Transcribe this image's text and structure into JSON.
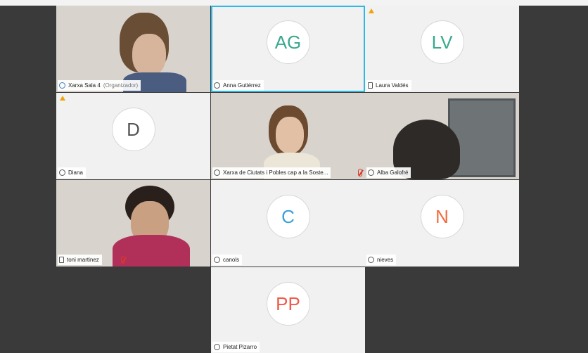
{
  "tiles": [
    {
      "type": "video",
      "name": "Xarxa Sala 4",
      "sub": "(Organizador)",
      "icon": "people-icon"
    },
    {
      "type": "avatar",
      "initials": "AG",
      "color": "#3aa98f",
      "name": "Anna Gutiérrez",
      "icon": "status-icon",
      "active": true
    },
    {
      "type": "avatar",
      "initials": "LV",
      "color": "#3aa98f",
      "name": "Laura Valdés",
      "icon": "phone-icon",
      "warning": true
    },
    {
      "type": "avatar",
      "initials": "D",
      "color": "#555555",
      "name": "Diana",
      "icon": "status-icon",
      "warning": true
    },
    {
      "type": "video",
      "name": "Xarxa de Ciutats i Pobles cap a la Soste...",
      "icon": "status-icon",
      "muted": true
    },
    {
      "type": "video",
      "name": "Alba Galofré",
      "icon": "status-icon"
    },
    {
      "type": "video",
      "name": "toni martinez",
      "icon": "phone-icon",
      "muted": true
    },
    {
      "type": "avatar",
      "initials": "C",
      "color": "#3aa0d8",
      "name": "canols",
      "icon": "status-icon"
    },
    {
      "type": "avatar",
      "initials": "N",
      "color": "#f06b3c",
      "name": "nieves",
      "icon": "status-icon"
    },
    {
      "type": "avatar",
      "initials": "PP",
      "color": "#f05a4a",
      "name": "Pietat Pizarro",
      "icon": "status-icon"
    }
  ],
  "colors": {
    "active_border": "#2fb8e6",
    "warning": "#f0a30a",
    "muted": "#d9362b"
  }
}
